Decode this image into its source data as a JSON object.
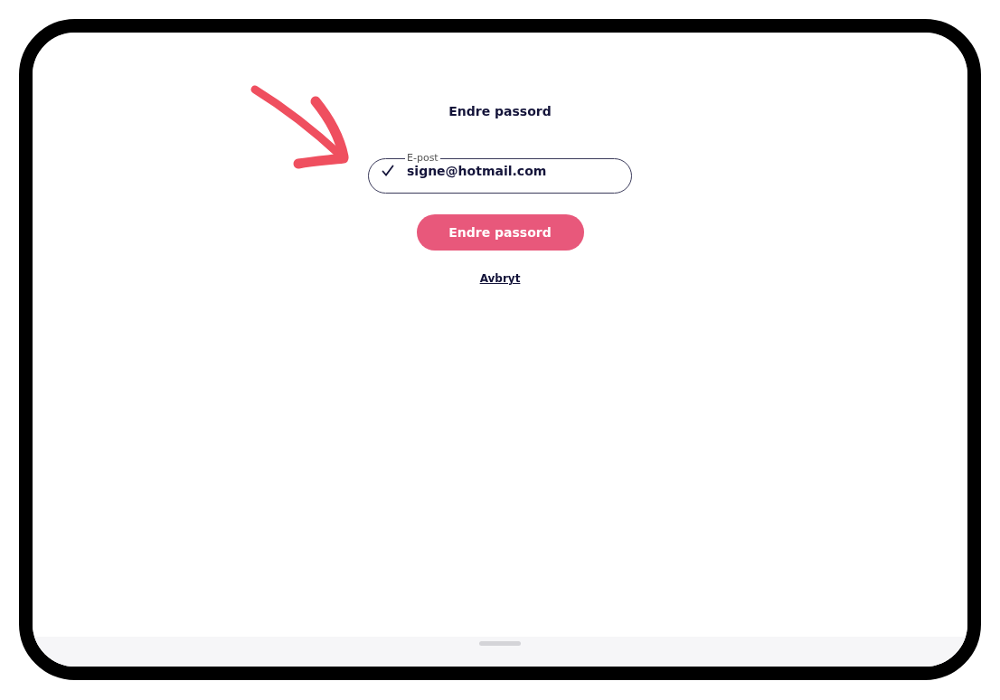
{
  "title": "Endre passord",
  "email_field": {
    "label": "E-post",
    "value": "signe@hotmail.com",
    "valid": true
  },
  "submit_button": "Endre passord",
  "cancel_link": "Avbryt"
}
